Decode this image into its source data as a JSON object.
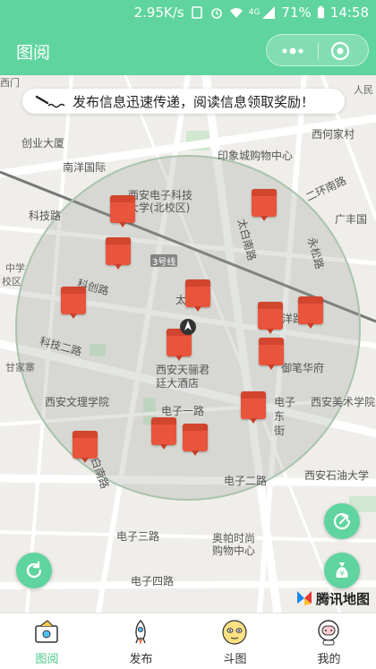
{
  "status_bar": {
    "speed": "2.95K/s",
    "network": "4G",
    "battery": "71%",
    "time": "14:58"
  },
  "nav": {
    "title": "图阅"
  },
  "banner": {
    "text": "发布信息迅速传递，阅读信息领取奖励！"
  },
  "map": {
    "labels": [
      "西门",
      "人民",
      "创业大厦",
      "西何家村",
      "南洋国际",
      "印象城购物中心",
      "西安电子科技",
      "大学(北校区)",
      "二环南路",
      "科技路",
      "太白南路",
      "广丰国",
      "永松路",
      "3号线",
      "中学",
      "校区",
      "科创路",
      "太白",
      "洋路",
      "科技二路",
      "甘家寨",
      "西安天骊君",
      "廷大酒店",
      "御笔华府",
      "西安文理学院",
      "西安美术学院",
      "电子一路",
      "电子",
      "东",
      "街",
      "太白南路",
      "电子二路",
      "西安石油大学",
      "电子三路",
      "奥帕时尚",
      "购物中心",
      "电子四路"
    ],
    "attribution": "腾讯地图"
  },
  "tabs": [
    {
      "label": "图阅",
      "icon": "map-tab-icon",
      "active": true
    },
    {
      "label": "发布",
      "icon": "rocket-icon",
      "active": false
    },
    {
      "label": "斗图",
      "icon": "emoji-face-icon",
      "active": false
    },
    {
      "label": "我的",
      "icon": "astronaut-icon",
      "active": false
    }
  ],
  "colors": {
    "accent": "#5fd49e",
    "pin": "#e8553c",
    "radius": "#9fb8a5"
  }
}
